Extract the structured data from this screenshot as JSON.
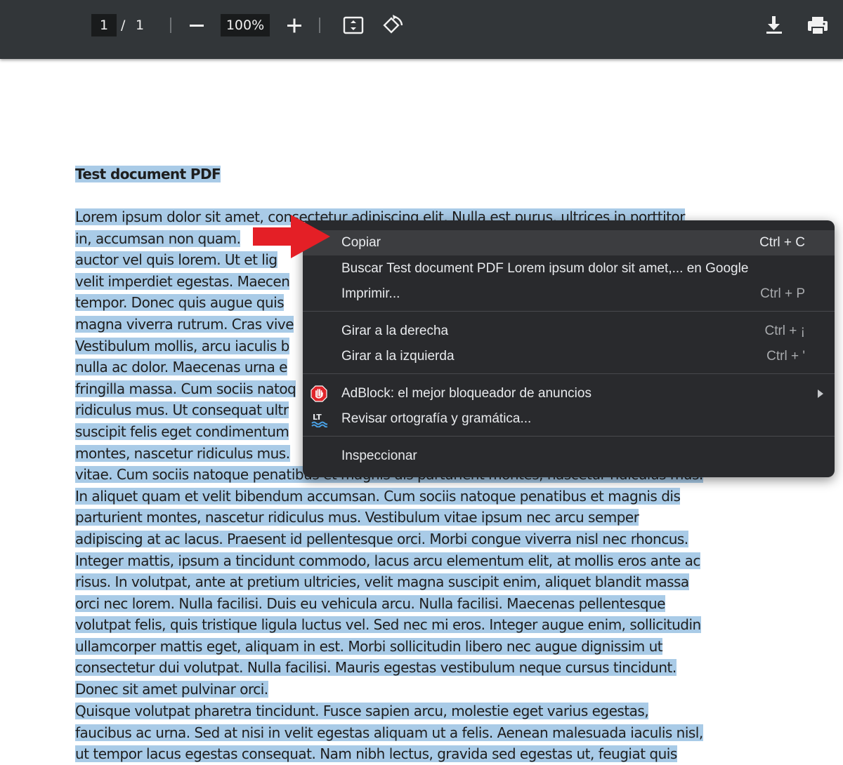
{
  "toolbar": {
    "page_current": "1",
    "page_separator": "/",
    "page_total": "1",
    "zoom": "100%"
  },
  "document": {
    "title": "Test document PDF",
    "para1": [
      "Lorem ipsum dolor sit amet, consectetur adipiscing elit. Nulla est purus, ultrices in porttitor",
      "in, accumsan non quam.",
      "auctor vel quis lorem. Ut et lig",
      "velit imperdiet egestas. Maecen",
      "tempor. Donec quis augue quis",
      "magna viverra rutrum. Cras vive",
      "Vestibulum mollis, arcu iaculis b",
      "nulla ac dolor. Maecenas urna e",
      "fringilla massa. Cum sociis natoq",
      "ridiculus mus. Ut consequat ultr",
      "suscipit felis eget condimentum",
      "montes, nascetur ridiculus mus.",
      "vitae. Cum sociis natoque penatibus et magnis dis parturient montes, nascetur ridiculus mus.",
      "In aliquet quam et velit bibendum accumsan. Cum sociis natoque penatibus et magnis dis",
      "parturient montes, nascetur ridiculus mus. Vestibulum vitae ipsum nec arcu semper",
      "adipiscing at ac lacus. Praesent id pellentesque orci. Morbi congue viverra nisl nec rhoncus.",
      "Integer mattis, ipsum a tincidunt commodo, lacus arcu elementum elit, at mollis eros ante ac",
      "risus. In volutpat, ante at pretium ultricies, velit magna suscipit enim, aliquet blandit massa",
      "orci nec lorem. Nulla facilisi. Duis eu vehicula arcu. Nulla facilisi. Maecenas pellentesque",
      "volutpat felis, quis tristique ligula luctus vel. Sed nec mi eros. Integer augue enim, sollicitudin",
      "ullamcorper mattis eget, aliquam in est. Morbi sollicitudin libero nec augue dignissim ut",
      "consectetur dui volutpat. Nulla facilisi. Mauris egestas vestibulum neque cursus tincidunt.",
      "Donec sit amet pulvinar orci."
    ],
    "para2": [
      "Quisque volutpat pharetra tincidunt. Fusce sapien arcu, molestie eget varius egestas,",
      "faucibus ac urna. Sed at nisi in velit egestas aliquam ut a felis. Aenean malesuada iaculis nisl,",
      "ut tempor lacus egestas consequat. Nam nibh lectus, gravida sed egestas ut, feugiat quis"
    ]
  },
  "context_menu": {
    "copy": {
      "label": "Copiar",
      "shortcut": "Ctrl + C"
    },
    "search": {
      "label": "Buscar Test document PDF  Lorem ipsum dolor sit amet,... en Google"
    },
    "print": {
      "label": "Imprimir...",
      "shortcut": "Ctrl + P"
    },
    "rotate_right": {
      "label": "Girar a la derecha",
      "shortcut": "Ctrl + ¡"
    },
    "rotate_left": {
      "label": "Girar a la izquierda",
      "shortcut": "Ctrl + '"
    },
    "adblock": {
      "label": "AdBlock: el mejor bloqueador de anuncios",
      "icon": "adblock-hand-icon"
    },
    "spellcheck": {
      "label": "Revisar ortografía y gramática...",
      "icon": "languagetool-icon"
    },
    "inspect": {
      "label": "Inspeccionar"
    }
  },
  "colors": {
    "toolbar_bg": "#323639",
    "selection": "#a9cbe7",
    "menu_bg": "#292a2d",
    "arrow": "#e41f26",
    "adblock": "#e0242a"
  }
}
